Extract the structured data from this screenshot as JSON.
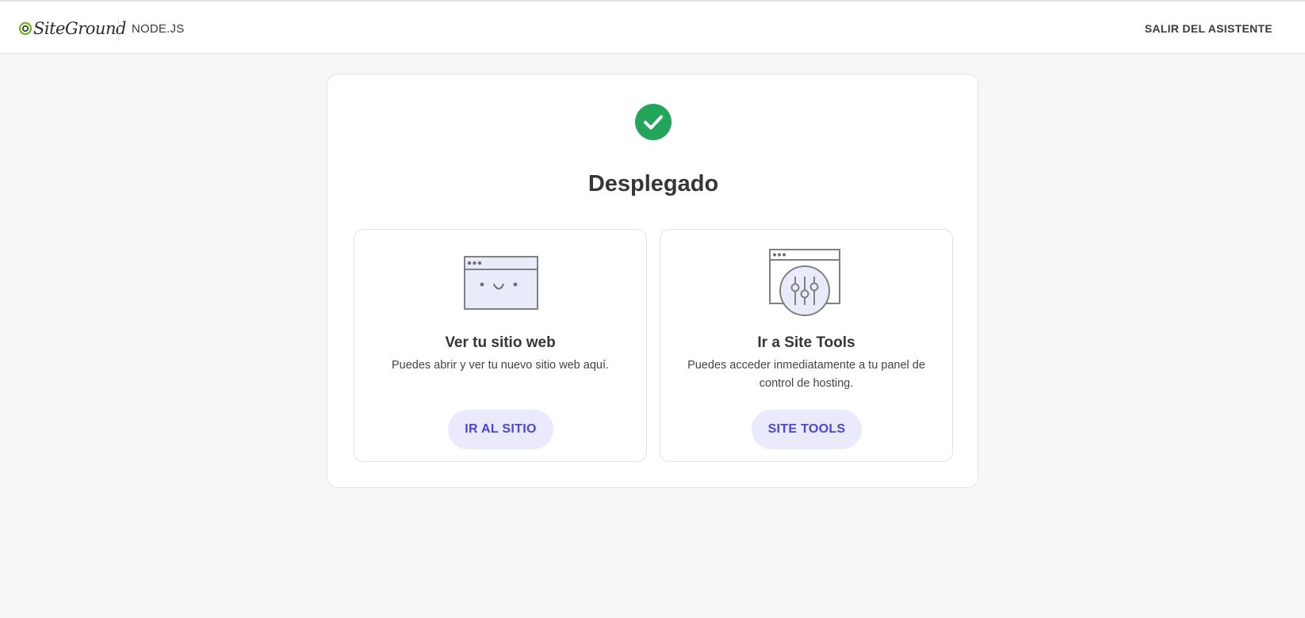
{
  "header": {
    "brand": "SiteGround",
    "section": "NODE.JS",
    "exit_label": "SALIR DEL ASISTENTE"
  },
  "status": {
    "icon": "check-circle-icon",
    "title": "Desplegado"
  },
  "cards": [
    {
      "icon": "browser-smiley-icon",
      "title": "Ver tu sitio web",
      "description": "Puedes abrir y ver tu nuevo sitio web aquí.",
      "button_label": "IR AL SITIO"
    },
    {
      "icon": "browser-sliders-icon",
      "title": "Ir a Site Tools",
      "description": "Puedes acceder inmediatamente a tu panel de control de hosting.",
      "button_label": "SITE TOOLS"
    }
  ],
  "colors": {
    "success": "#23a55a",
    "brand_green": "#7ab629",
    "accent": "#4a45d8",
    "accent_bg": "#ebeafc"
  }
}
